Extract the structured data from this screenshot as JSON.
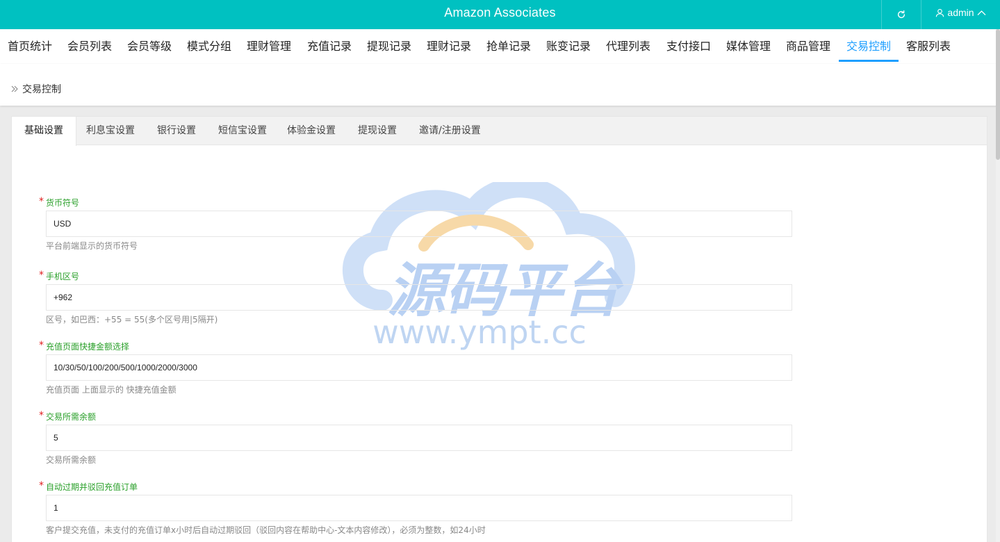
{
  "header": {
    "app_title": "Amazon Associates",
    "user_name": "admin"
  },
  "nav": {
    "items": [
      "首页统计",
      "会员列表",
      "会员等级",
      "模式分组",
      "理财管理",
      "充值记录",
      "提现记录",
      "理财记录",
      "抢单记录",
      "账变记录",
      "代理列表",
      "支付接口",
      "媒体管理",
      "商品管理",
      "交易控制",
      "客服列表"
    ],
    "active": "交易控制"
  },
  "breadcrumb": {
    "current": "交易控制"
  },
  "tabs": {
    "items": [
      "基础设置",
      "利息宝设置",
      "银行设置",
      "短信宝设置",
      "体验金设置",
      "提现设置",
      "邀请/注册设置"
    ],
    "active": "基础设置"
  },
  "form": {
    "fields": [
      {
        "label": "货币符号",
        "value": "USD",
        "hint": "平台前端显示的货币符号"
      },
      {
        "label": "手机区号",
        "value": "+962",
        "hint": "区号，如巴西：+55 = 55(多个区号用|5隔开)"
      },
      {
        "label": "充值页面快捷金额选择",
        "value": "10/30/50/100/200/500/1000/2000/3000",
        "hint": "充值页面 上面显示的 快捷充值金额"
      },
      {
        "label": "交易所需余额",
        "value": "5",
        "hint": "交易所需余额"
      },
      {
        "label": "自动过期并驳回充值订单",
        "value": "1",
        "hint": "客户提交充值，未支付的充值订单x小时后自动过期驳回（驳回内容在帮助中心-文本内容修改），必须为整数，如24小时"
      }
    ]
  },
  "watermark": {
    "text_cn": "源码平台",
    "text_url": "www.ympt.cc",
    "colors": {
      "cloud": "#cfe0f7",
      "arc": "#f7d9a8",
      "text": "#b9d1f3"
    }
  },
  "colors": {
    "header_bg": "#00c1c1",
    "accent": "#1e9fff",
    "label_green": "#2aa02a",
    "required_red": "#e02020"
  }
}
